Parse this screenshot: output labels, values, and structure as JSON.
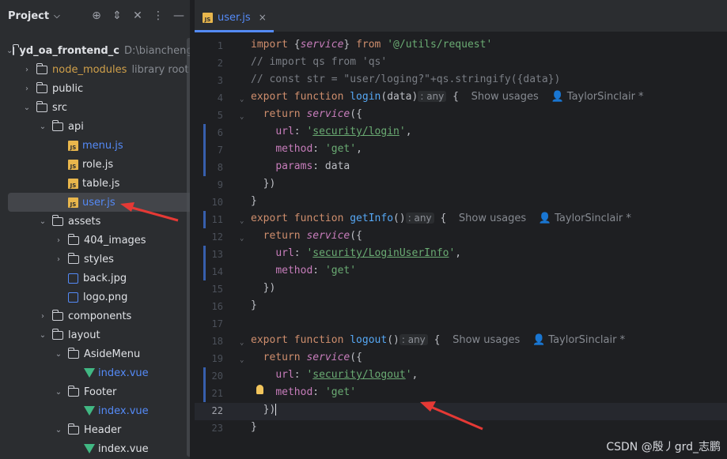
{
  "project_panel": {
    "title": "Project",
    "tree": [
      {
        "label": "yd_oa_frontend_c",
        "hint": "D:\\biancheng\\V",
        "indent": 0,
        "kind": "folder",
        "open": true,
        "bold": true
      },
      {
        "label": "node_modules",
        "hint": "library root",
        "indent": 1,
        "kind": "folder",
        "open": false,
        "color": "orange"
      },
      {
        "label": "public",
        "hint": "",
        "indent": 1,
        "kind": "folder",
        "open": false
      },
      {
        "label": "src",
        "hint": "",
        "indent": 1,
        "kind": "folder",
        "open": true
      },
      {
        "label": "api",
        "hint": "",
        "indent": 2,
        "kind": "folder",
        "open": true
      },
      {
        "label": "menu.js",
        "hint": "",
        "indent": 3,
        "kind": "js",
        "color": "blue"
      },
      {
        "label": "role.js",
        "hint": "",
        "indent": 3,
        "kind": "js"
      },
      {
        "label": "table.js",
        "hint": "",
        "indent": 3,
        "kind": "js"
      },
      {
        "label": "user.js",
        "hint": "",
        "indent": 3,
        "kind": "js",
        "color": "blue",
        "selected": true
      },
      {
        "label": "assets",
        "hint": "",
        "indent": 2,
        "kind": "folder",
        "open": true
      },
      {
        "label": "404_images",
        "hint": "",
        "indent": 3,
        "kind": "folder",
        "open": false
      },
      {
        "label": "styles",
        "hint": "",
        "indent": 3,
        "kind": "folder",
        "open": false
      },
      {
        "label": "back.jpg",
        "hint": "",
        "indent": 3,
        "kind": "img"
      },
      {
        "label": "logo.png",
        "hint": "",
        "indent": 3,
        "kind": "img"
      },
      {
        "label": "components",
        "hint": "",
        "indent": 2,
        "kind": "folder",
        "open": false
      },
      {
        "label": "layout",
        "hint": "",
        "indent": 2,
        "kind": "folder",
        "open": true
      },
      {
        "label": "AsideMenu",
        "hint": "",
        "indent": 3,
        "kind": "folder",
        "open": true
      },
      {
        "label": "index.vue",
        "hint": "",
        "indent": 4,
        "kind": "vue",
        "color": "blue"
      },
      {
        "label": "Footer",
        "hint": "",
        "indent": 3,
        "kind": "folder",
        "open": true
      },
      {
        "label": "index.vue",
        "hint": "",
        "indent": 4,
        "kind": "vue",
        "color": "blue"
      },
      {
        "label": "Header",
        "hint": "",
        "indent": 3,
        "kind": "folder",
        "open": true
      },
      {
        "label": "index.vue",
        "hint": "",
        "indent": 4,
        "kind": "vue"
      }
    ]
  },
  "editor": {
    "tab_label": "user.js",
    "tab_close": "×",
    "line_numbers": [
      "1",
      "2",
      "3",
      "4",
      "5",
      "6",
      "7",
      "8",
      "9",
      "10",
      "11",
      "12",
      "13",
      "14",
      "15",
      "16",
      "17",
      "18",
      "19",
      "20",
      "21",
      "22",
      "23"
    ],
    "current_line": "22",
    "usages": "Show usages",
    "author": "TaylorSinclair *",
    "any": ": any"
  },
  "watermark": "CSDN @殷丿grd_志鹏",
  "colors": {
    "accent": "#548af7",
    "arrow": "#e53935"
  }
}
